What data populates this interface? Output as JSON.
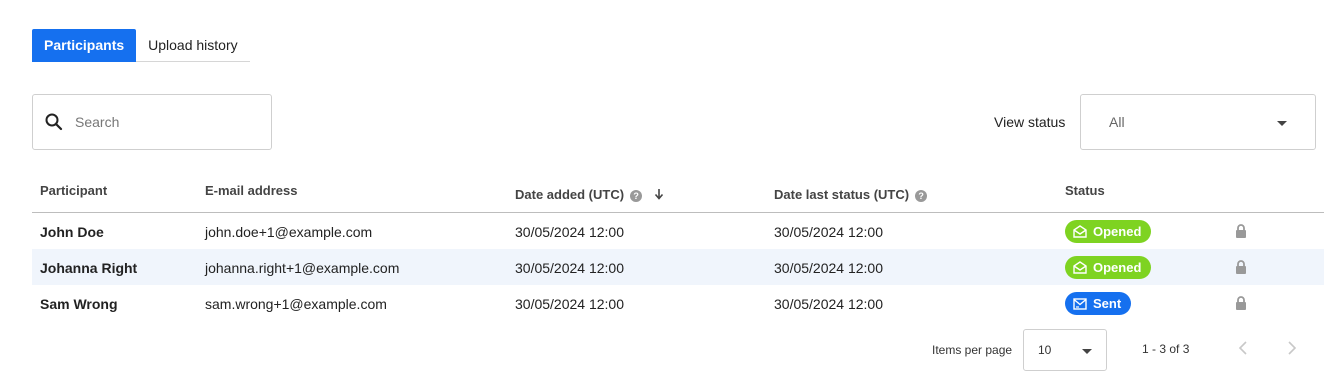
{
  "tabs": [
    {
      "label": "Participants",
      "active": true
    },
    {
      "label": "Upload history",
      "active": false
    }
  ],
  "search": {
    "placeholder": "Search",
    "value": ""
  },
  "view_status": {
    "label": "View status",
    "selected": "All"
  },
  "table": {
    "columns": {
      "participant": "Participant",
      "email": "E-mail address",
      "date_added": "Date added (UTC)",
      "date_last_status": "Date last status (UTC)",
      "status": "Status"
    },
    "rows": [
      {
        "participant": "John Doe",
        "email": "john.doe+1@example.com",
        "date_added": "30/05/2024 12:00",
        "date_last_status": "30/05/2024 12:00",
        "status": "Opened"
      },
      {
        "participant": "Johanna Right",
        "email": "johanna.right+1@example.com",
        "date_added": "30/05/2024 12:00",
        "date_last_status": "30/05/2024 12:00",
        "status": "Opened"
      },
      {
        "participant": "Sam Wrong",
        "email": "sam.wrong+1@example.com",
        "date_added": "30/05/2024 12:00",
        "date_last_status": "30/05/2024 12:00",
        "status": "Sent"
      }
    ]
  },
  "pagination": {
    "items_per_page_label": "Items per page",
    "items_per_page": "10",
    "range": "1 - 3 of 3",
    "prev_icon": "chevron-left-icon",
    "next_icon": "chevron-right-icon"
  },
  "colors": {
    "accent": "#1570ef",
    "opened": "#7ed321",
    "sent": "#1570ef",
    "row_alt": "#f0f5fc"
  },
  "icons": {
    "search": "search-icon",
    "info": "info-icon",
    "sort": "arrow-down-icon",
    "envelope-open": "envelope-open-icon",
    "envelope": "envelope-icon",
    "lock": "lock-icon"
  }
}
